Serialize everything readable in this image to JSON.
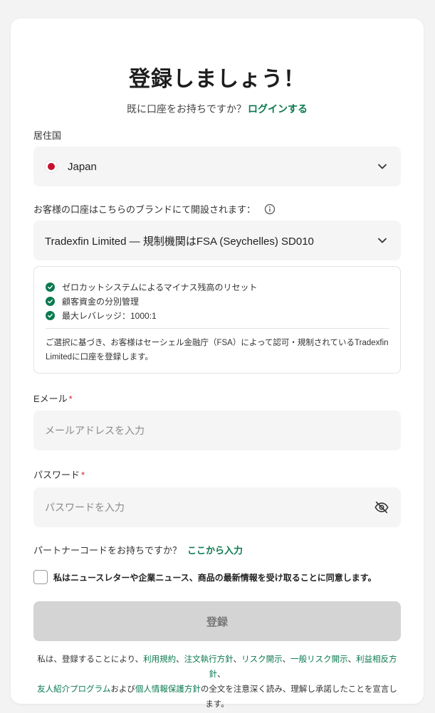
{
  "header": {
    "title": "登録しましょう！",
    "login_prompt": "既に口座をお持ちですか？",
    "login_link": "ログインする"
  },
  "country": {
    "label": "居住国",
    "value": "Japan"
  },
  "brand": {
    "label": "お客様の口座はこちらのブランドにて開設されます：",
    "value": "Tradexfin Limited — 規制機関はFSA (Seychelles) SD010",
    "features": [
      "ゼロカットシステムによるマイナス残高のリセット",
      "顧客資金の分別管理",
      "最大レバレッジ：1000:1"
    ],
    "note": "ご選択に基づき、お客様はセーシェル金融庁（FSA）によって認可・規制されているTradexfin Limitedに口座を登録します。"
  },
  "email": {
    "label": "Eメール",
    "required_mark": "*",
    "placeholder": "メールアドレスを入力"
  },
  "password": {
    "label": "パスワード",
    "required_mark": "*",
    "placeholder": "パスワードを入力"
  },
  "partner": {
    "prompt": "パートナーコードをお持ちですか？",
    "link": "ここから入力"
  },
  "consent": {
    "checked": false,
    "label": "私はニュースレターや企業ニュース、商品の最新情報を受け取ることに同意します。"
  },
  "submit": {
    "label": "登録"
  },
  "legal": {
    "prefix": "私は、登録することにより、",
    "links": [
      "利用規約",
      "注文執行方針",
      "リスク開示",
      "一般リスク開示",
      "利益相反方針",
      "友人紹介プログラム",
      "個人情報保護方針"
    ],
    "sep": "、",
    "and": "および",
    "suffix": "の全文を注意深く読み、理解し承諾したことを宣言します。"
  },
  "colors": {
    "accent": "#0a7a4f",
    "required": "#d0243a",
    "field_bg": "#f5f5f5",
    "button_disabled": "#d4d4d4"
  }
}
